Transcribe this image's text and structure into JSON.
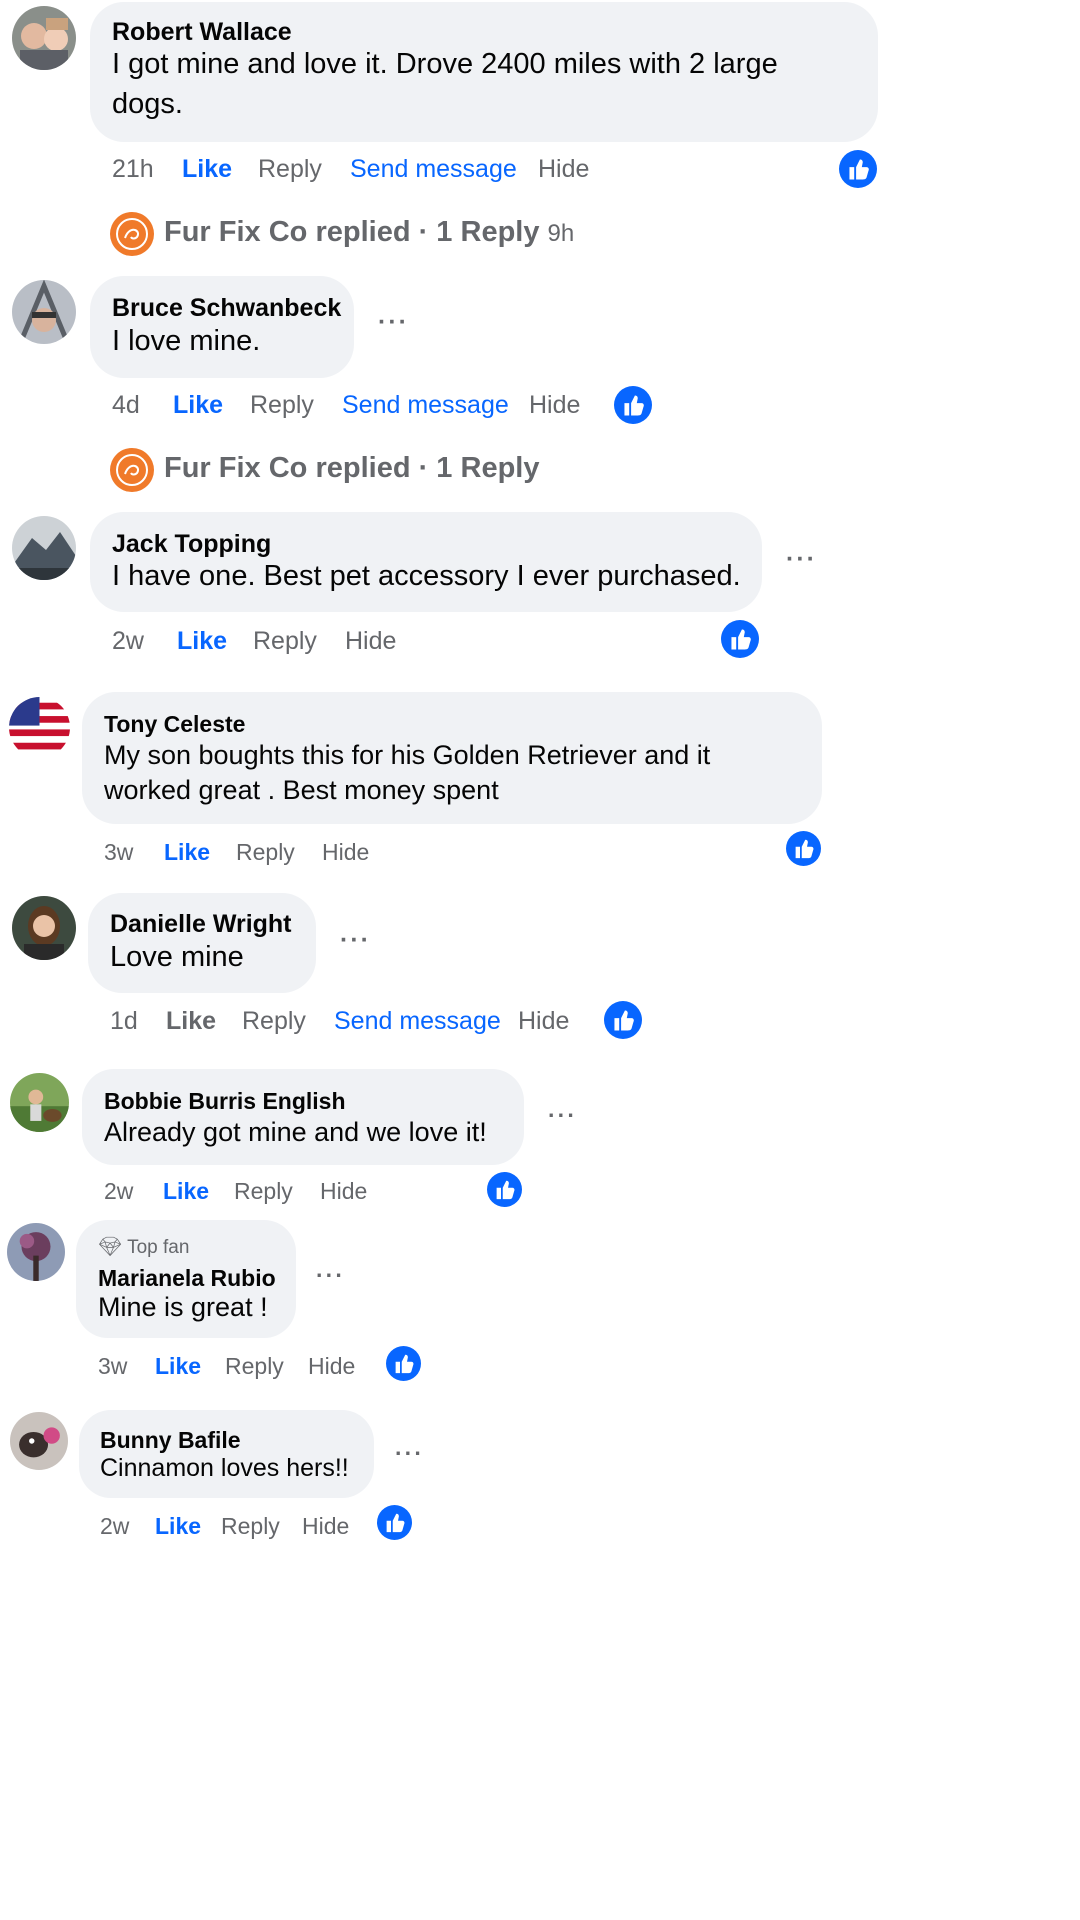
{
  "colors": {
    "like_blue": "#0866ff",
    "meta_gray": "#65676b",
    "bubble_bg": "#f0f2f5",
    "text": "#050505",
    "brand_orange": "#f07a2a"
  },
  "icons": {
    "reaction": "like-thumbs-up-icon",
    "more": "more-options-icon",
    "badge": "diamond-icon"
  },
  "comments": [
    {
      "name": "Robert Wallace",
      "lines": [
        "I got mine and love it. Drove 2400 miles with 2 large",
        "dogs."
      ],
      "time": "21h",
      "like": "Like",
      "reply": "Reply",
      "message": "Send message",
      "hide": "Hide",
      "replied": {
        "page": "Fur Fix Co",
        "text": "replied · 1 Reply",
        "time": "9h"
      }
    },
    {
      "name": "Bruce Schwanbeck",
      "lines": [
        "I love mine."
      ],
      "time": "4d",
      "like": "Like",
      "reply": "Reply",
      "message": "Send message",
      "hide": "Hide",
      "replied": {
        "page": "Fur Fix Co",
        "text": "replied · 1 Reply"
      }
    },
    {
      "name": "Jack Topping",
      "lines": [
        "I have one. Best pet accessory I ever purchased."
      ],
      "time": "2w",
      "like": "Like",
      "reply": "Reply",
      "hide": "Hide"
    },
    {
      "name": "Tony Celeste",
      "lines": [
        "My son boughts this for his Golden Retriever and it",
        "worked great . Best money spent"
      ],
      "time": "3w",
      "like": "Like",
      "reply": "Reply",
      "hide": "Hide"
    },
    {
      "name": "Danielle Wright",
      "lines": [
        "Love mine"
      ],
      "time": "1d",
      "like": "Like",
      "reply": "Reply",
      "message": "Send message",
      "hide": "Hide"
    },
    {
      "name": "Bobbie Burris English",
      "lines": [
        "Already got mine and we love it!"
      ],
      "time": "2w",
      "like": "Like",
      "reply": "Reply",
      "hide": "Hide"
    },
    {
      "badge": "Top fan",
      "name": "Marianela Rubio",
      "lines": [
        "Mine is great !"
      ],
      "time": "3w",
      "like": "Like",
      "reply": "Reply",
      "hide": "Hide"
    },
    {
      "name": "Bunny Bafile",
      "lines": [
        "Cinnamon loves hers!!"
      ],
      "time": "2w",
      "like": "Like",
      "reply": "Reply",
      "hide": "Hide"
    }
  ]
}
